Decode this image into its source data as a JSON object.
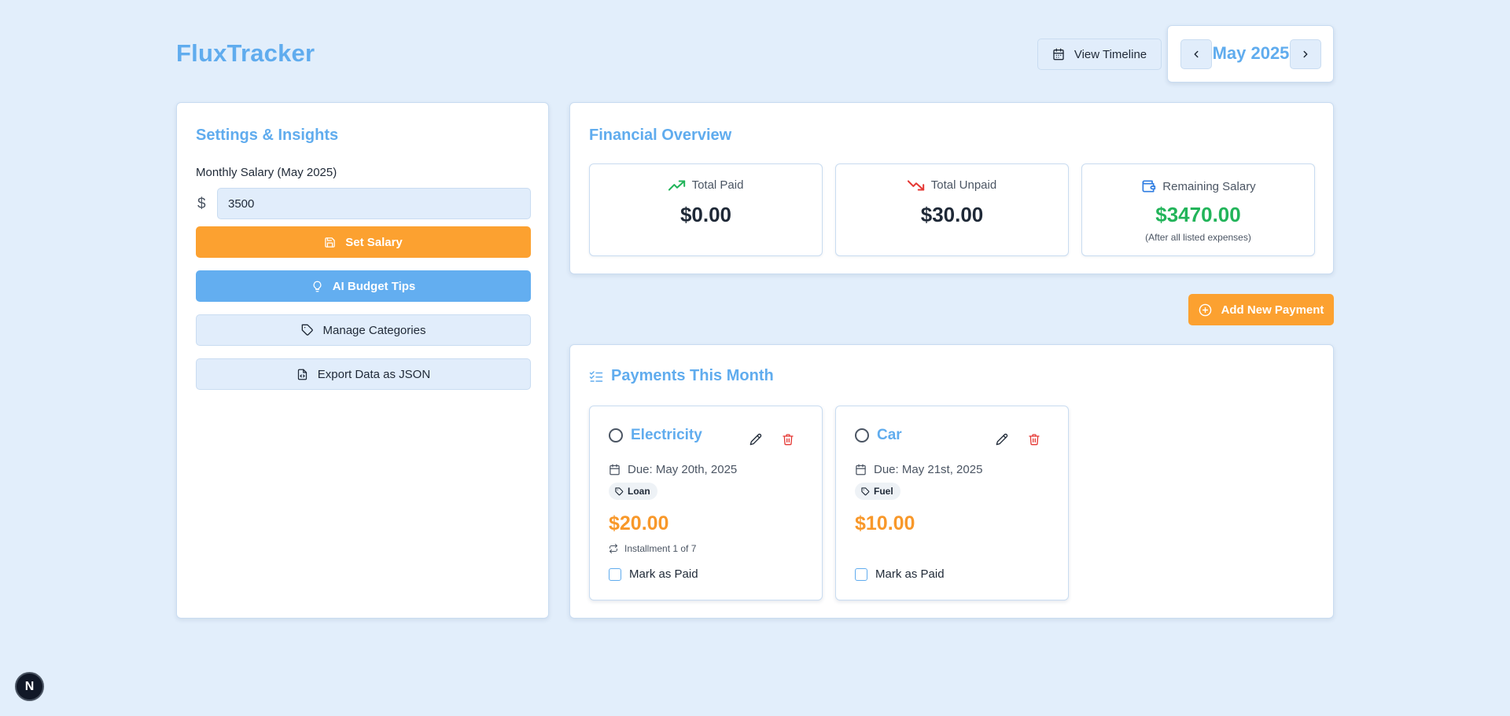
{
  "header": {
    "app_title": "FluxTracker",
    "view_timeline_label": "View Timeline",
    "month_label": "May 2025"
  },
  "settings": {
    "title": "Settings & Insights",
    "salary_label": "Monthly Salary (May 2025)",
    "currency_symbol": "$",
    "salary_value": "3500",
    "set_salary_label": "Set Salary",
    "ai_tips_label": "AI Budget Tips",
    "manage_categories_label": "Manage Categories",
    "export_label": "Export Data as JSON"
  },
  "overview": {
    "title": "Financial Overview",
    "stats": [
      {
        "label": "Total Paid",
        "value": "$0.00",
        "icon": "trending-up-icon"
      },
      {
        "label": "Total Unpaid",
        "value": "$30.00",
        "icon": "trending-down-icon"
      },
      {
        "label": "Remaining Salary",
        "value": "$3470.00",
        "note": "(After all listed expenses)",
        "icon": "wallet-icon"
      }
    ]
  },
  "add_payment_label": "Add New Payment",
  "payments": {
    "title": "Payments This Month",
    "items": [
      {
        "name": "Electricity",
        "due": "Due: May 20th, 2025",
        "tag": "Loan",
        "amount": "$20.00",
        "installment": "Installment 1 of 7",
        "mark_label": "Mark as Paid"
      },
      {
        "name": "Car",
        "due": "Due: May 21st, 2025",
        "tag": "Fuel",
        "amount": "$10.00",
        "mark_label": "Mark as Paid"
      }
    ]
  },
  "dev_badge": "N",
  "colors": {
    "accent_blue": "#60acee",
    "accent_orange": "#fca130",
    "background": "#e2eefb",
    "green": "#22b45a",
    "red": "#e53935"
  }
}
